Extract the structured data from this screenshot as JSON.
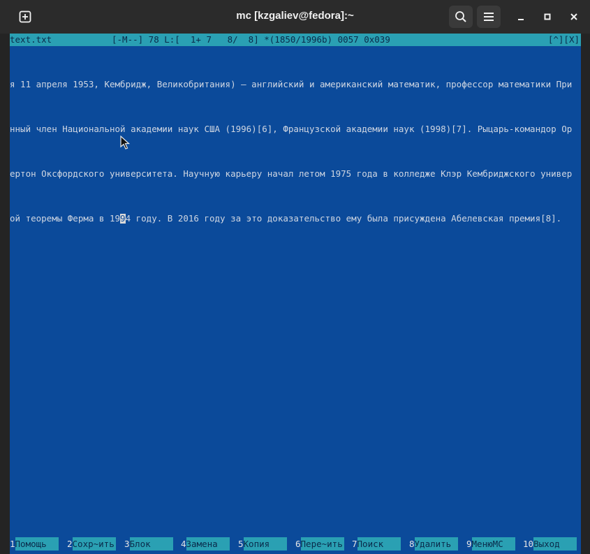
{
  "window": {
    "title": "mc [kzgaliev@fedora]:~",
    "newtab_icon": "plus-square-icon",
    "search_icon": "search-icon",
    "menu_icon": "hamburger-icon",
    "minimize_icon": "minimize-icon",
    "maximize_icon": "maximize-icon",
    "close_icon": "close-icon"
  },
  "editor": {
    "filename": "text.txt",
    "status": "[-M--] 78 L:[  1+ 7   8/  8] *(1850/1996b) 0057 0x039",
    "status_btn_up": "[^]",
    "status_btn_close": "[X]",
    "lines": [
      "я 11 апреля 1953, Кембридж, Великобритания) — английский и американский математик, профессор математики При",
      "нный член Национальной академии наук США (1996)[6], Французской академии наук (1998)[7]. Рыцарь-командор Ор",
      "ертон Оксфордского университета. Научную карьеру начал летом 1975 года в колледже Клэр Кембриджского универ"
    ],
    "cursor_line": {
      "before": "ой теоремы Ферма в 19",
      "cursor_char": "9",
      "after": "4 году. В 2016 году за это доказательство ему была присуждена Абелевская премия[8]. "
    }
  },
  "function_keys": [
    {
      "num": "1",
      "label": "Помощь"
    },
    {
      "num": "2",
      "label": "Сохр~ить"
    },
    {
      "num": "3",
      "label": "Блок"
    },
    {
      "num": "4",
      "label": "Замена"
    },
    {
      "num": "5",
      "label": "Копия"
    },
    {
      "num": "6",
      "label": "Пере~ить"
    },
    {
      "num": "7",
      "label": "Поиск"
    },
    {
      "num": "8",
      "label": "Удалить"
    },
    {
      "num": "9",
      "label": "МенюMC"
    },
    {
      "num": "10",
      "label": "Выход"
    }
  ],
  "colors": {
    "editor_background": "#0b4a9a",
    "status_background": "#2aa0b3",
    "titlebar": "#2b2b2b"
  }
}
